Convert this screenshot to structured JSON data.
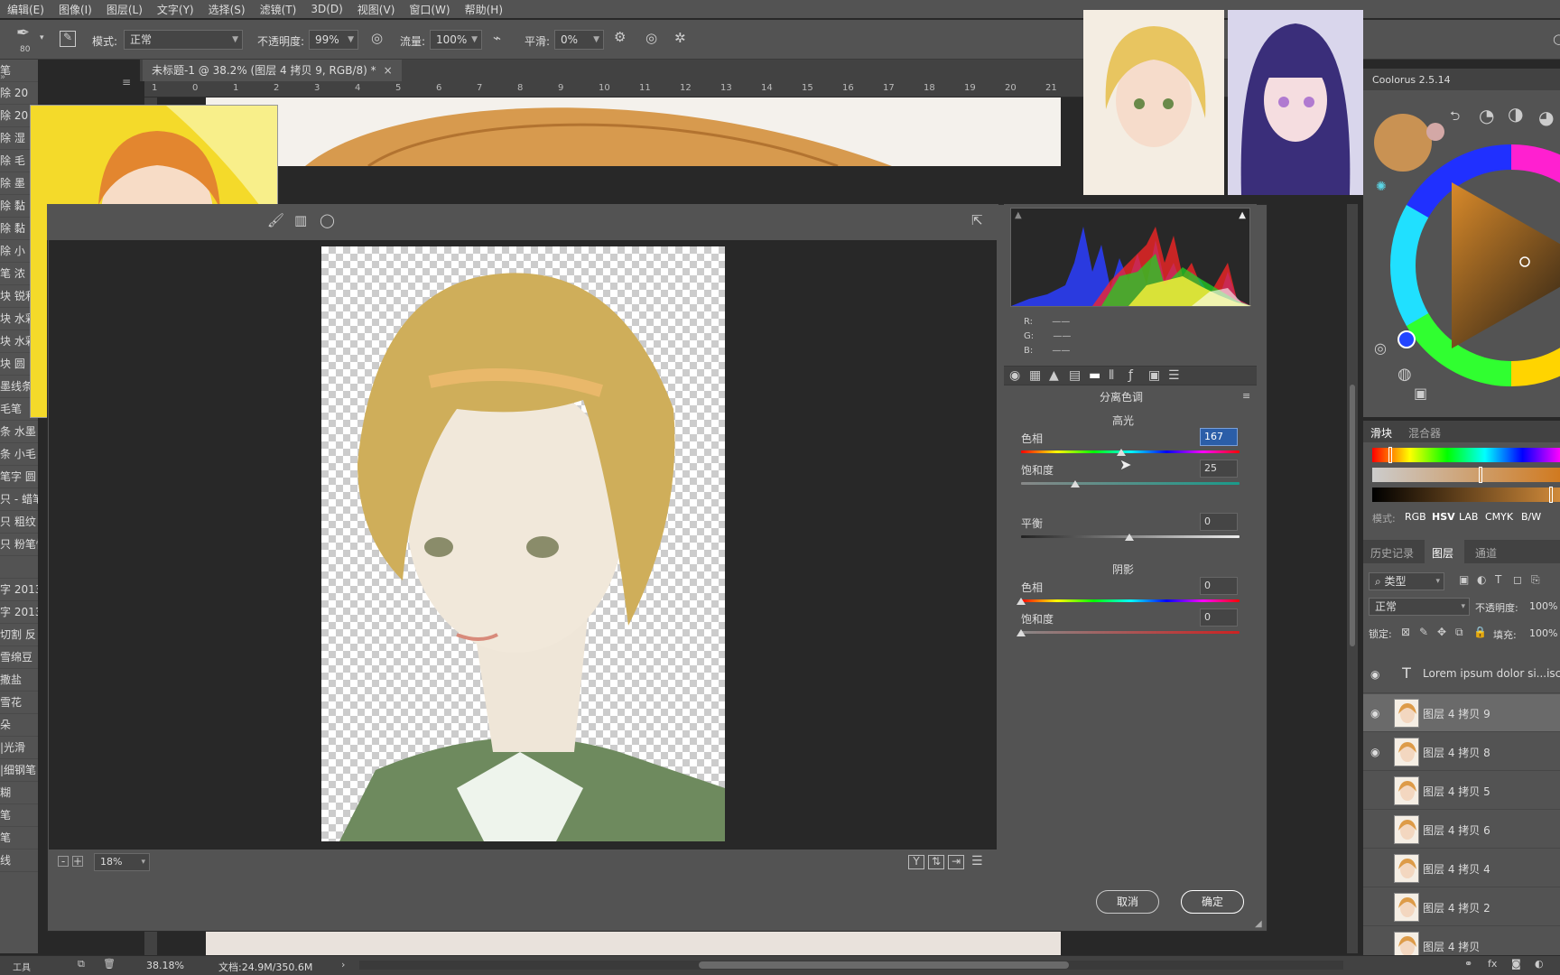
{
  "menu": [
    "编辑(E)",
    "图像(I)",
    "图层(L)",
    "文字(Y)",
    "选择(S)",
    "滤镜(T)",
    "3D(D)",
    "视图(V)",
    "窗口(W)",
    "帮助(H)"
  ],
  "options": {
    "brush_size": "80",
    "mode_label": "模式:",
    "mode_value": "正常",
    "opacity_label": "不透明度:",
    "opacity_value": "99%",
    "flow_label": "流量:",
    "flow_value": "100%",
    "smooth_label": "平滑:",
    "smooth_value": "0%"
  },
  "document_tab": "未标题-1 @ 38.2% (图层 4 拷贝 9, RGB/8) *",
  "ruler_ticks": [
    "1",
    "0",
    "1",
    "2",
    "3",
    "4",
    "5",
    "6",
    "7",
    "8",
    "9",
    "10",
    "11",
    "12",
    "13",
    "14",
    "15",
    "16",
    "17",
    "18",
    "19",
    "20",
    "21"
  ],
  "left_list": [
    "笔",
    "除 20",
    "除 20",
    "除 湿",
    "除 毛",
    "除 墨",
    "除 黏",
    "除 黏",
    "除 小",
    "笔 浓",
    "块 锐利",
    "块 水彩",
    "块 水彩",
    "块 圆",
    "墨线条",
    "毛笔",
    "条 水墨",
    "条 小毛",
    "笔字 圆",
    "只 - 蜡笔",
    "只 粗纹",
    "只 粉笔快",
    "",
    "字 2013",
    "字 2013",
    "切割 反",
    "雪绵豆",
    "撒盐",
    "雪花",
    "朵",
    "|光滑",
    "|细钢笔",
    "糊",
    "笔",
    "笔",
    "线"
  ],
  "dialog": {
    "panel_title": "分离色调",
    "rgb_labels": [
      "R:",
      "G:",
      "B:"
    ],
    "rgb_values": [
      "——",
      "——",
      "——"
    ],
    "highlights_title": "高光",
    "hue_label": "色相",
    "hue_value": "167",
    "sat_label": "饱和度",
    "sat_value": "25",
    "balance_label": "平衡",
    "balance_value": "0",
    "shadows_title": "阴影",
    "shadow_hue_label": "色相",
    "shadow_hue_value": "0",
    "shadow_sat_label": "饱和度",
    "shadow_sat_value": "0",
    "zoom_value": "18%",
    "cancel_label": "取消",
    "ok_label": "确定",
    "y_label": "Y"
  },
  "coolorus": {
    "title": "Coolorus 2.5.14",
    "current_color": "#c99253",
    "tab_sliders": "滑块",
    "tab_mixer": "混合器",
    "mode_label": "模式:",
    "modes": [
      "RGB",
      "HSV",
      "LAB",
      "CMYK",
      "B/W"
    ]
  },
  "layers": {
    "tabs": [
      "历史记录",
      "图层",
      "通道"
    ],
    "filter_label": "类型",
    "blend_value": "正常",
    "opacity_label": "不透明度:",
    "opacity_value": "100%",
    "lock_label": "锁定:",
    "fill_label": "填充:",
    "fill_value": "100%",
    "rows": [
      {
        "name": "Lorem ipsum dolor si...iscing",
        "visible": true,
        "type": "text"
      },
      {
        "name": "图层 4 拷贝 9",
        "visible": true,
        "type": "image",
        "selected": true
      },
      {
        "name": "图层 4 拷贝 8",
        "visible": true,
        "type": "image"
      },
      {
        "name": "图层 4 拷贝 5",
        "visible": false,
        "type": "image"
      },
      {
        "name": "图层 4 拷贝 6",
        "visible": false,
        "type": "image"
      },
      {
        "name": "图层 4 拷贝 4",
        "visible": false,
        "type": "image"
      },
      {
        "name": "图层 4 拷贝 2",
        "visible": false,
        "type": "image"
      },
      {
        "name": "图层 4 拷贝",
        "visible": false,
        "type": "image"
      }
    ]
  },
  "status": {
    "zoom": "38.18%",
    "doc": "文档:24.9M/350.6M",
    "tool": "工具"
  }
}
